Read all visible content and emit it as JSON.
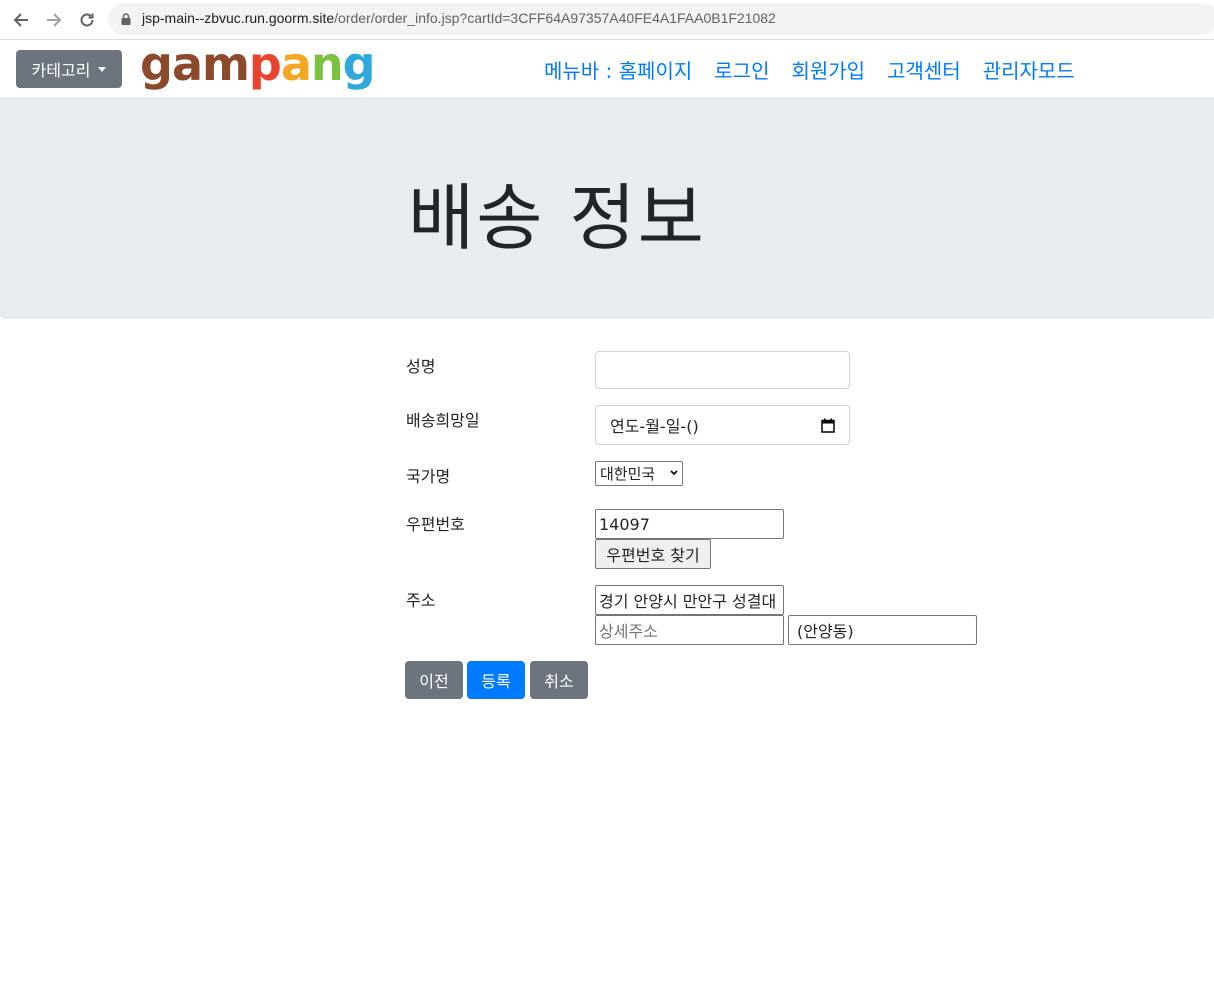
{
  "browser": {
    "url_host": "jsp-main--zbvuc.run.goorm.site",
    "url_path": "/order/order_info.jsp?cartId=3CFF64A97357A40FE4A1FAA0B1F21082"
  },
  "navbar": {
    "category_label": "카테고리",
    "logo_letters": [
      {
        "ch": "g",
        "color": "#8B4A2B"
      },
      {
        "ch": "a",
        "color": "#8B4A2B"
      },
      {
        "ch": "m",
        "color": "#8B4A2B"
      },
      {
        "ch": "p",
        "color": "#E8432C"
      },
      {
        "ch": "a",
        "color": "#F5A623"
      },
      {
        "ch": "n",
        "color": "#7CC242"
      },
      {
        "ch": "g",
        "color": "#2FA8DB"
      }
    ],
    "links": [
      "메뉴바 : 홈페이지",
      "로그인",
      "회원가입",
      "고객센터",
      "관리자모드"
    ]
  },
  "jumbotron": {
    "title": "배송 정보"
  },
  "form": {
    "name_label": "성명",
    "name_value": "",
    "date_label": "배송희망일",
    "date_value": "연도-월-일-()",
    "country_label": "국가명",
    "country_value": "대한민국",
    "zip_label": "우편번호",
    "zip_value": "14097",
    "zip_button": "우편번호 찾기",
    "address_label": "주소",
    "address_value": "경기 안양시 만안구 성결대",
    "detail_placeholder": "상세주소",
    "extra_value": "(안양동)"
  },
  "buttons": {
    "prev": "이전",
    "submit": "등록",
    "cancel": "취소"
  },
  "colors": {
    "primary": "#007bff",
    "secondary": "#6c757d",
    "jumbotron_bg": "#e9ecef"
  }
}
